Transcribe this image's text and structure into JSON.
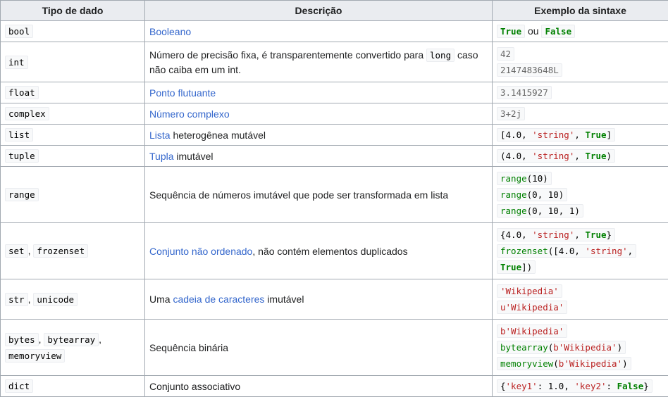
{
  "headers": {
    "type": "Tipo de dado",
    "desc": "Descrição",
    "example": "Exemplo da sintaxe"
  },
  "rows": {
    "bool": {
      "type": "bool",
      "desc_link": "Booleano",
      "ex_true": "True",
      "ex_or": "ou",
      "ex_false": "False"
    },
    "int": {
      "type": "int",
      "desc_a": "Número de precisão fixa, é transparentemente convertido para",
      "desc_code": "long",
      "desc_b": "caso não caiba em um int.",
      "ex1": "42",
      "ex2": "2147483648L"
    },
    "float": {
      "type": "float",
      "desc_link": "Ponto flutuante",
      "ex1": "3.1415927"
    },
    "complex": {
      "type": "complex",
      "desc_link": "Número complexo",
      "ex1": "3+2j"
    },
    "list": {
      "type": "list",
      "desc_link": "Lista",
      "desc_rest": "heterogênea mutável",
      "ex_open": "[4.0, ",
      "ex_str": "'string'",
      "ex_mid": ", ",
      "ex_true": "True",
      "ex_close": "]"
    },
    "tuple": {
      "type": "tuple",
      "desc_link": "Tupla",
      "desc_rest": "imutável",
      "ex_open": "(4.0, ",
      "ex_str": "'string'",
      "ex_mid": ", ",
      "ex_true": "True",
      "ex_close": ")"
    },
    "range": {
      "type": "range",
      "desc": "Sequência de números imutável que pode ser transformada em lista",
      "fn": "range",
      "ex1_args": "(10)",
      "ex2_args": "(0, 10)",
      "ex3_args": "(0, 10, 1)"
    },
    "set": {
      "type1": "set",
      "comma": ",",
      "type2": "frozenset",
      "desc_link": "Conjunto não ordenado",
      "desc_rest": ", não contém elementos duplicados",
      "ex1_open": "{4.0, ",
      "ex1_str": "'string'",
      "ex1_mid": ", ",
      "ex1_true": "True",
      "ex1_close": "}",
      "ex2_fn": "frozenset",
      "ex2_open": "([4.0, ",
      "ex2_str": "'string'",
      "ex2_mid": ",",
      "ex2_true": "True",
      "ex2_close": "])"
    },
    "str": {
      "type1": "str",
      "comma": ",",
      "type2": "unicode",
      "desc_a": "Uma",
      "desc_link": "cadeia de caracteres",
      "desc_b": "imutável",
      "ex1": "'Wikipedia'",
      "ex2": "u'Wikipedia'"
    },
    "bytes": {
      "type1": "bytes",
      "comma1": ",",
      "type2": "bytearray",
      "comma2": ",",
      "type3": "memoryview",
      "desc": "Sequência binária",
      "ex1": "b'Wikipedia'",
      "ex2_fn": "bytearray",
      "ex3_fn": "memoryview",
      "ex_arg": "b'Wikipedia'",
      "p_open": "(",
      "p_close": ")"
    },
    "dict": {
      "type": "dict",
      "desc": "Conjunto associativo",
      "ex_open": "{",
      "k1": "'key1'",
      "v1": ": 1.0, ",
      "k2": "'key2'",
      "v2": ": ",
      "ex_false": "False",
      "ex_close": "}"
    }
  }
}
